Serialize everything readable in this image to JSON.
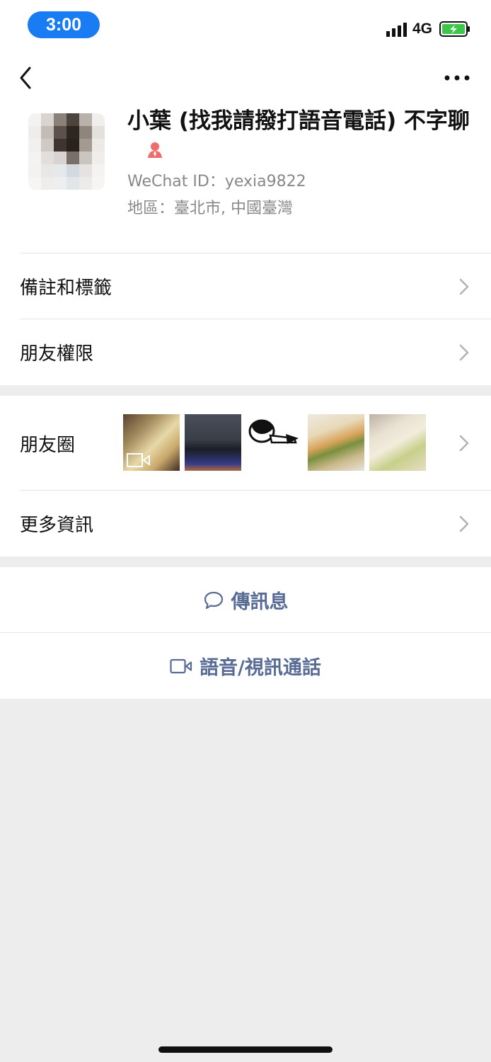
{
  "status_bar": {
    "time": "3:00",
    "network": "4G"
  },
  "profile": {
    "name": "小葉 (找我請撥打語音電話) 不字聊",
    "wechat_id": "WeChat ID：yexia9822",
    "region": "地區：臺北市, 中國臺灣"
  },
  "menu": {
    "remarks_tags": "備註和標籤",
    "friend_permissions": "朋友權限",
    "moments": "朋友圈",
    "more_info": "更多資訊"
  },
  "actions": {
    "send_message": "傳訊息",
    "voice_video_call": "語音/視訊通話"
  },
  "colors": {
    "accent_link": "#576b95",
    "time_pill": "#1a7cf2",
    "battery": "#3cc64a",
    "gender_female": "#f06b6b"
  }
}
